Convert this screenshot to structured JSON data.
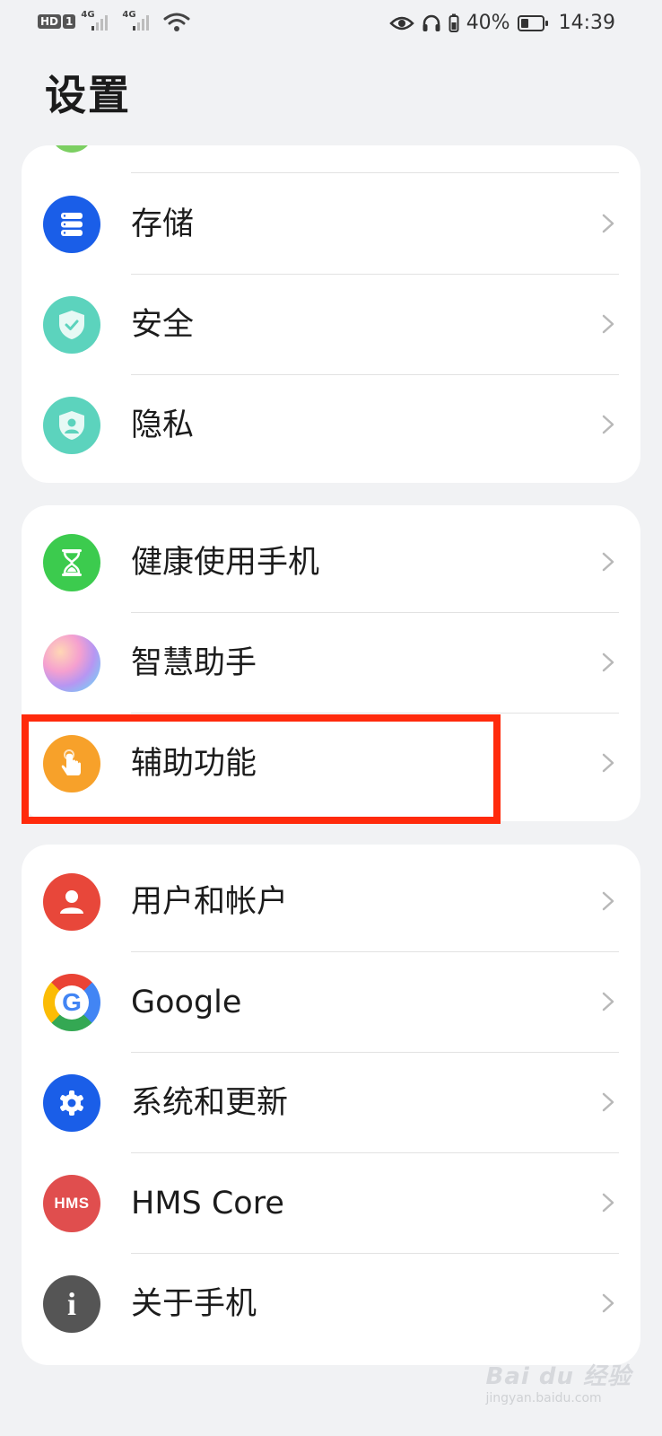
{
  "status_bar": {
    "hd_label": "HD",
    "sim_label": "1",
    "net1": "4G",
    "net2": "4G",
    "battery_percent": "40%",
    "battery_level": 0.4,
    "time": "14:39"
  },
  "header": {
    "title": "设置"
  },
  "groups": [
    {
      "items": [
        {
          "label": "存储",
          "icon": "storage-icon",
          "color": "#1a5ee8"
        },
        {
          "label": "安全",
          "icon": "security-shield-icon",
          "color": "#5cd3bd"
        },
        {
          "label": "隐私",
          "icon": "privacy-shield-icon",
          "color": "#5cd3bd"
        }
      ]
    },
    {
      "items": [
        {
          "label": "健康使用手机",
          "icon": "hourglass-icon",
          "color": "#3ccb4e"
        },
        {
          "label": "智慧助手",
          "icon": "assistant-orb-icon",
          "color": "#f3a9d4"
        },
        {
          "label": "辅助功能",
          "icon": "accessibility-hand-icon",
          "color": "#f7a12a"
        }
      ]
    },
    {
      "items": [
        {
          "label": "用户和帐户",
          "icon": "user-icon",
          "color": "#e8473a"
        },
        {
          "label": "Google",
          "icon": "google-icon",
          "color": "#ffffff"
        },
        {
          "label": "系统和更新",
          "icon": "gear-icon",
          "color": "#1a5ee8"
        },
        {
          "label": "HMS Core",
          "icon": "hms-icon",
          "color": "#e04e4e",
          "icon_text": "HMS"
        },
        {
          "label": "关于手机",
          "icon": "info-icon",
          "color": "#555555",
          "icon_text": "i"
        }
      ]
    }
  ],
  "highlight_color": "#ff2a0c",
  "watermark": {
    "text": "Bai du 经验",
    "sub": "jingyan.baidu.com"
  }
}
